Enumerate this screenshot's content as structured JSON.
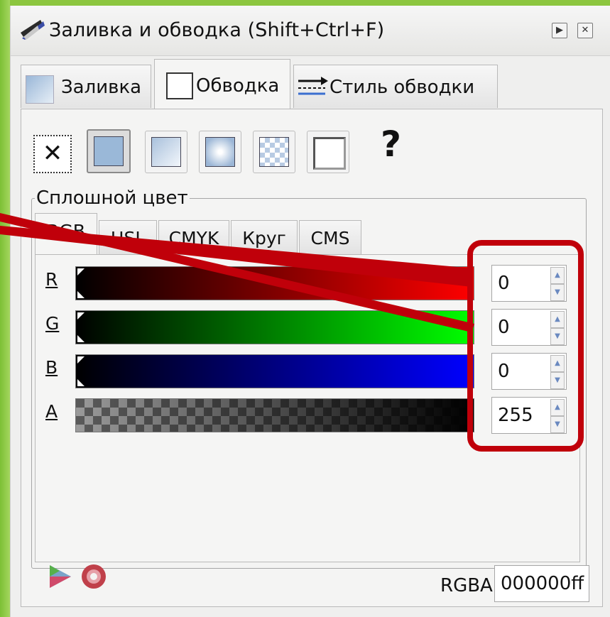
{
  "window": {
    "title": "Заливка и обводка (Shift+Ctrl+F)",
    "buttons": [
      "▶",
      "✕"
    ]
  },
  "tabs": [
    {
      "label": "Заливка",
      "active": false
    },
    {
      "label": "Обводка",
      "active": true
    },
    {
      "label": "Стиль обводки",
      "active": false
    }
  ],
  "paint_modes": {
    "none_label": "✕",
    "unset_label": "?",
    "items": [
      "flat",
      "linear-gradient",
      "radial-gradient",
      "pattern",
      "swatch"
    ]
  },
  "section": {
    "legend": "Сплошной цвет"
  },
  "color_tabs": [
    {
      "label": "RGB",
      "active": true
    },
    {
      "label": "HSL",
      "active": false
    },
    {
      "label": "CMYK",
      "active": false
    },
    {
      "label": "Круг",
      "active": false
    },
    {
      "label": "CMS",
      "active": false
    }
  ],
  "channels": [
    {
      "label": "R",
      "value": "0",
      "color": "#ff0000"
    },
    {
      "label": "G",
      "value": "0",
      "color": "#00ff00"
    },
    {
      "label": "B",
      "value": "0",
      "color": "#0000ff"
    },
    {
      "label": "A",
      "value": "255",
      "color": "#000000"
    }
  ],
  "rgba": {
    "label": "RGBA:",
    "value": "000000ff"
  },
  "annotation": {
    "color": "#c0000a"
  }
}
